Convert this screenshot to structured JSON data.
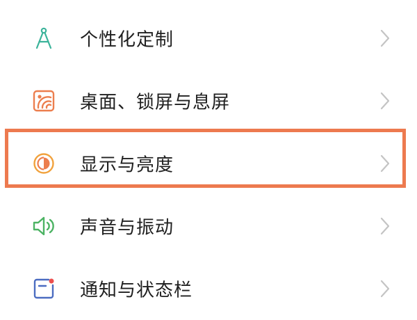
{
  "settings": {
    "items": [
      {
        "label": "个性化定制",
        "icon": "compass-icon",
        "icon_color": "#3bb39a"
      },
      {
        "label": "桌面、锁屏与息屏",
        "icon": "wallpaper-icon",
        "icon_color": "#ec7e4e"
      },
      {
        "label": "显示与亮度",
        "icon": "brightness-icon",
        "icon_color": "#f1a23d"
      },
      {
        "label": "声音与振动",
        "icon": "speaker-icon",
        "icon_color": "#4cb363"
      },
      {
        "label": "通知与状态栏",
        "icon": "notification-icon",
        "icon_color": "#4b6cc1"
      }
    ],
    "highlighted_item": "显示与亮度",
    "highlight_color": "#ed7a4f",
    "chevron_color": "#c4c4c4"
  }
}
